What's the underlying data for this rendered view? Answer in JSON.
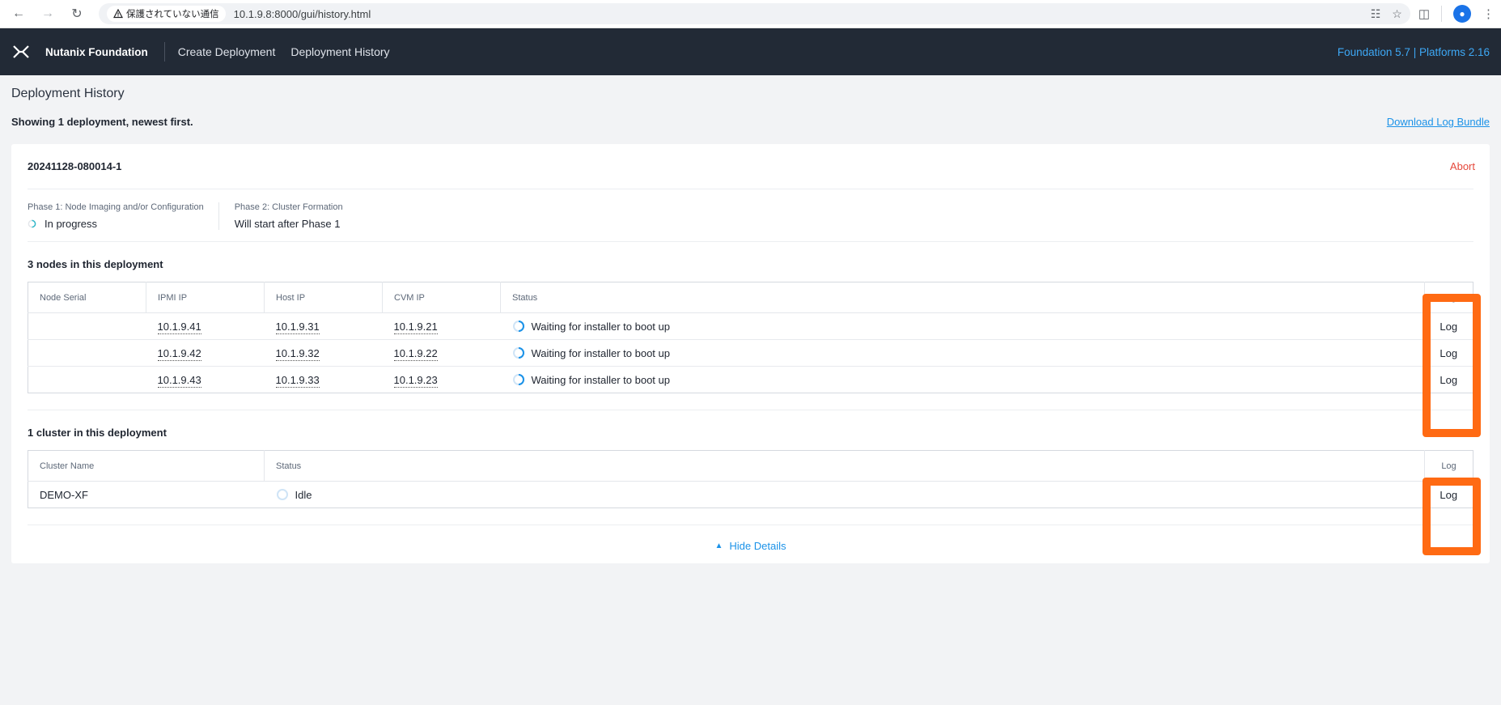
{
  "browser": {
    "security_label": "保護されていない通信",
    "url": "10.1.9.8:8000/gui/history.html"
  },
  "header": {
    "brand": "Nutanix Foundation",
    "nav": [
      "Create Deployment",
      "Deployment History"
    ],
    "version": "Foundation 5.7 | Platforms 2.16"
  },
  "page": {
    "title": "Deployment History",
    "showing": "Showing 1 deployment, newest first.",
    "download_link": "Download Log Bundle"
  },
  "deployment": {
    "id": "20241128-080014-1",
    "abort_label": "Abort",
    "phase1_label": "Phase 1: Node Imaging and/or Configuration",
    "phase1_status": "In progress",
    "phase2_label": "Phase 2: Cluster Formation",
    "phase2_status": "Will start after Phase 1",
    "nodes_title": "3 nodes in this deployment",
    "node_columns": [
      "Node Serial",
      "IPMI IP",
      "Host IP",
      "CVM IP",
      "Status",
      "Log"
    ],
    "nodes": [
      {
        "serial": "",
        "ipmi": "10.1.9.41",
        "host": "10.1.9.31",
        "cvm": "10.1.9.21",
        "status": "Waiting for installer to boot up",
        "log": "Log"
      },
      {
        "serial": "",
        "ipmi": "10.1.9.42",
        "host": "10.1.9.32",
        "cvm": "10.1.9.22",
        "status": "Waiting for installer to boot up",
        "log": "Log"
      },
      {
        "serial": "",
        "ipmi": "10.1.9.43",
        "host": "10.1.9.33",
        "cvm": "10.1.9.23",
        "status": "Waiting for installer to boot up",
        "log": "Log"
      }
    ],
    "clusters_title": "1 cluster in this deployment",
    "cluster_columns": [
      "Cluster Name",
      "Status",
      "Log"
    ],
    "clusters": [
      {
        "name": "DEMO-XF",
        "status": "Idle",
        "log": "Log"
      }
    ],
    "hide_details": "Hide Details"
  },
  "colors": {
    "header_bg": "#222a36",
    "accent": "#1b92e8",
    "abort": "#e5483b",
    "highlight": "#ff6a13"
  }
}
